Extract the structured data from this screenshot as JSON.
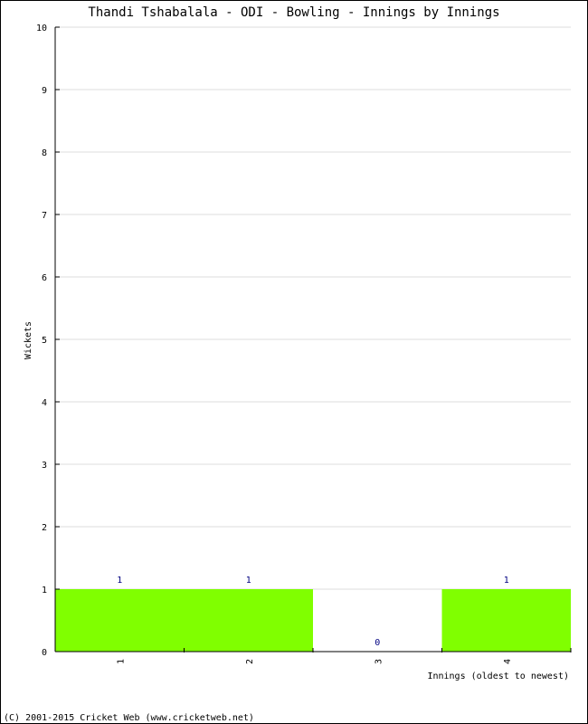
{
  "chart_data": {
    "type": "bar",
    "title": "Thandi Tshabalala - ODI - Bowling - Innings by Innings",
    "xlabel": "Innings (oldest to newest)",
    "ylabel": "Wickets",
    "categories": [
      "1",
      "2",
      "3",
      "4"
    ],
    "values": [
      1,
      1,
      0,
      1
    ],
    "data_labels": [
      "1",
      "1",
      "0",
      "1"
    ],
    "ylim": [
      0,
      10
    ],
    "yticks": [
      0,
      1,
      2,
      3,
      4,
      5,
      6,
      7,
      8,
      9,
      10
    ],
    "grid": true,
    "bar_color": "#80ff00",
    "label_color": "#000080"
  },
  "footer": "(C) 2001-2015 Cricket Web (www.cricketweb.net)"
}
